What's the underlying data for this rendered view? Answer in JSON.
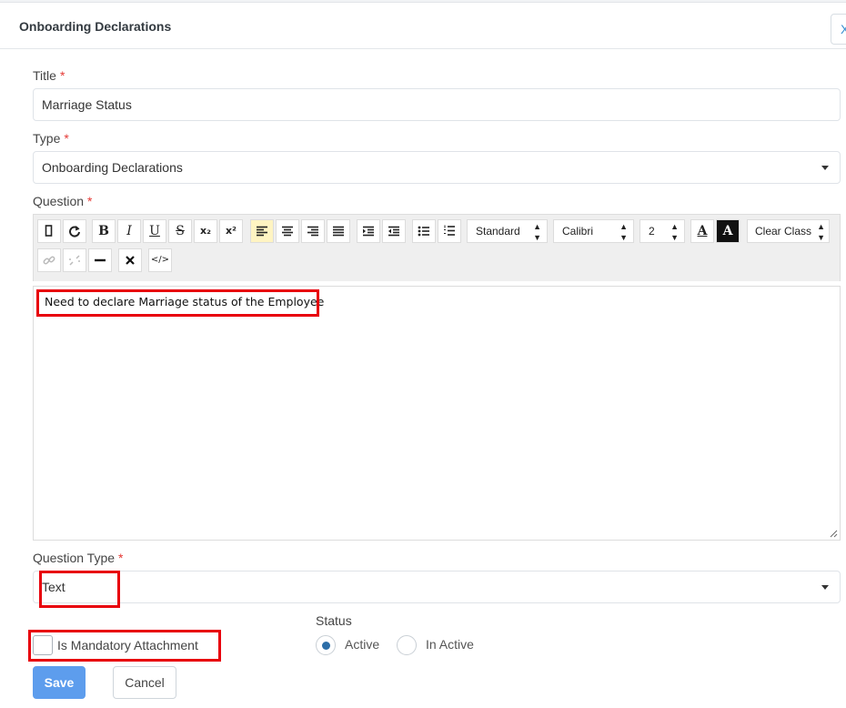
{
  "dialog": {
    "title": "Onboarding Declarations",
    "close_glyph": "X"
  },
  "form": {
    "title_label": "Title",
    "title_value": "Marriage Status",
    "type_label": "Type",
    "type_value": "Onboarding Declarations",
    "question_label": "Question",
    "question_text": "Need to declare Marriage status of the Employee",
    "question_type_label": "Question Type",
    "question_type_value": "Text",
    "required_mark": "*",
    "mandatory_attachment_label": "Is Mandatory Attachment",
    "mandatory_attachment_checked": false,
    "status_label": "Status",
    "status_options": [
      {
        "label": "Active",
        "checked": true
      },
      {
        "label": "In Active",
        "checked": false
      }
    ]
  },
  "toolbar": {
    "block_select": "Standard",
    "font_select": "Calibri",
    "size_select": "2",
    "style_select": "Clear Class",
    "subscript_label": "x₂",
    "superscript_label": "x²",
    "bold_label": "B",
    "italic_label": "I",
    "underline_label": "U",
    "strike_label": "S",
    "text_color_label": "A",
    "bg_color_label": "A",
    "code_label": "</>"
  },
  "buttons": {
    "save": "Save",
    "cancel": "Cancel"
  },
  "annotations": {
    "highlight_color": "#e8000b"
  },
  "colors": {
    "primary": "#5d9ded",
    "required": "#e53935",
    "radio_checked": "#2d6ea8"
  }
}
